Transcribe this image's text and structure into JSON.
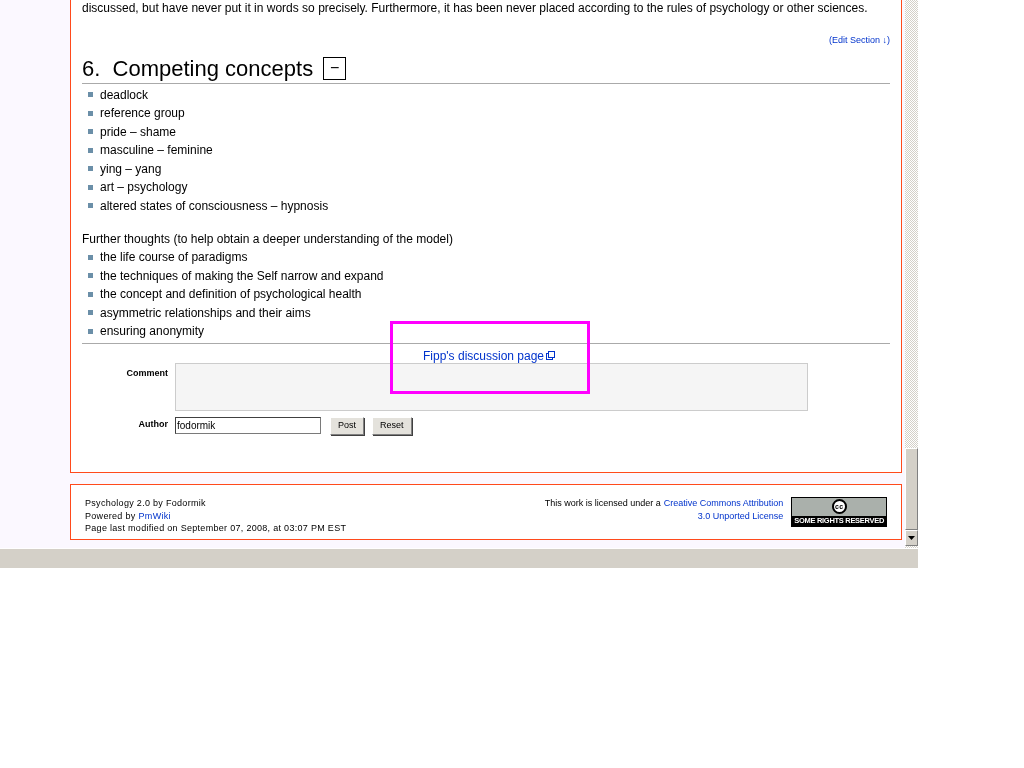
{
  "intro_text": "discussed, but have never put it in words so precisely. Furthermore, it has been never placed according to the rules of psychology or other sciences.",
  "edit_section": "(Edit Section ↓)",
  "section": {
    "number": "6.",
    "title": "Competing concepts",
    "toggle": "−",
    "expanded": true
  },
  "concepts": [
    "deadlock",
    "reference group",
    "pride – shame",
    "masculine – feminine",
    "ying – yang",
    "art – psychology",
    "altered states of consciousness – hypnosis"
  ],
  "further_heading": "Further thoughts (to help obtain a deeper understanding of the model)",
  "further": [
    "the life course of paradigms",
    "the techniques of making the Self narrow and expand",
    "the concept and definition of psychological health",
    "asymmetric relationships and their aims",
    "ensuring anonymity"
  ],
  "discussion_link": "Fipp's discussion page",
  "form": {
    "comment_label": "Comment",
    "author_label": "Author",
    "author_value": "fodormik",
    "buttons": [
      "Post",
      "Reset"
    ]
  },
  "footer": {
    "line1": "Psychology 2.0 by Fodormik",
    "powered_by": "Powered by",
    "pmwiki_link": "PmWiki",
    "modified": "Page last modified on September 07, 2008, at 03:07 PM EST",
    "license_text": "This work is licensed under a",
    "license_link_1": "Creative Commons Attribution",
    "license_link_2": "3.0 Unported License",
    "badge_text": "SOME RIGHTS RESERVED",
    "badge_logo": "cc"
  }
}
